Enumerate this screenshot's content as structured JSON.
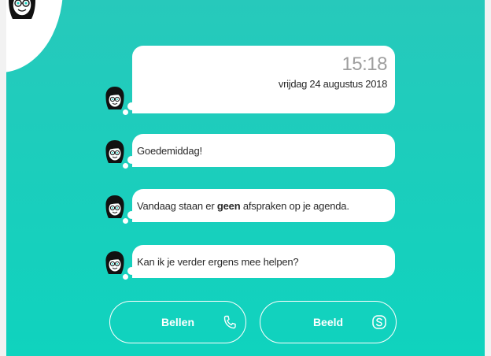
{
  "header": {
    "avatar_icon": "assistant-avatar-icon"
  },
  "clock": {
    "time": "15:18",
    "date": "vrijdag 24 augustus 2018"
  },
  "messages": [
    {
      "before": "Goedemiddag!",
      "bold": "",
      "after": ""
    },
    {
      "before": "Vandaag staan er ",
      "bold": "geen",
      "after": " afspraken op je agenda."
    },
    {
      "before": "Kan ik je verder ergens mee helpen?",
      "bold": "",
      "after": ""
    }
  ],
  "actions": {
    "call": {
      "label": "Bellen",
      "icon": "phone-icon"
    },
    "video": {
      "label": "Beeld",
      "icon": "skype-icon"
    }
  },
  "colors": {
    "background": "#1dcfbf",
    "bubble": "#ffffff",
    "text": "#2a2a2a",
    "clock": "#9e9e9e"
  }
}
